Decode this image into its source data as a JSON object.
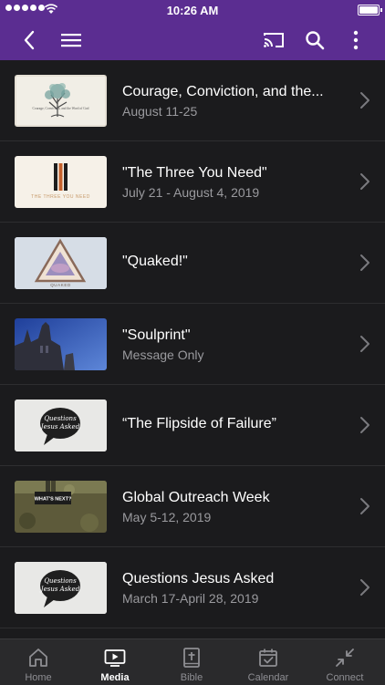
{
  "status_bar": {
    "time": "10:26 AM"
  },
  "media_list": [
    {
      "title": "Courage, Conviction, and the...",
      "subtitle": "August 11-25",
      "thumb": "tree-drawing-thumbnail"
    },
    {
      "title": "\"The Three You Need\"",
      "subtitle": "July 21 - August 4, 2019",
      "thumb": "three-bars-thumbnail"
    },
    {
      "title": "\"Quaked!\"",
      "subtitle": "",
      "thumb": "triangle-photo-thumbnail"
    },
    {
      "title": "\"Soulprint\"",
      "subtitle": "Message Only",
      "thumb": "cathedral-photo-thumbnail"
    },
    {
      "title": "“The Flipside of Failure”",
      "subtitle": "",
      "thumb": "speech-bubble-thumbnail"
    },
    {
      "title": "Global Outreach Week",
      "subtitle": "May 5-12, 2019",
      "thumb": "outreach-photo-thumbnail"
    },
    {
      "title": "Questions Jesus Asked",
      "subtitle": "March 17-April 28, 2019",
      "thumb": "speech-bubble-thumbnail"
    }
  ],
  "thumb_text": {
    "tree": "Courage, Conviction, and the Word of God",
    "three": "THE THREE YOU NEED",
    "quaked": "QUAKED",
    "bubble_line1": "Questions",
    "bubble_line2": "Jesus Asked",
    "outreach_line1": "WHAT'S NEXT?"
  },
  "tab_bar": {
    "tabs": [
      {
        "label": "Home",
        "icon": "home-icon",
        "active": false
      },
      {
        "label": "Media",
        "icon": "media-icon",
        "active": true
      },
      {
        "label": "Bible",
        "icon": "bible-icon",
        "active": false
      },
      {
        "label": "Calendar",
        "icon": "calendar-icon",
        "active": false
      },
      {
        "label": "Connect",
        "icon": "connect-icon",
        "active": false
      }
    ]
  },
  "colors": {
    "brand": "#5b2d91",
    "background": "#1b1b1d",
    "tabbar": "#2a2a2c"
  }
}
